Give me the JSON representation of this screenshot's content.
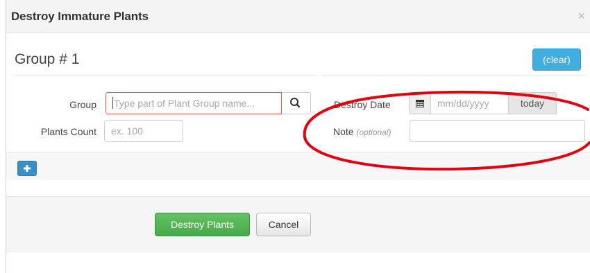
{
  "modal": {
    "title": "Destroy Immature Plants",
    "close_glyph": "×"
  },
  "group": {
    "title": "Group # 1",
    "clear_label": "(clear)",
    "group_label": "Group",
    "group_placeholder": "Type part of Plant Group name...",
    "search_icon": "search-icon",
    "plants_count_label": "Plants Count",
    "plants_count_placeholder": "ex. 100",
    "destroy_date_label": "Destroy Date",
    "calendar_icon": "calendar-icon",
    "date_placeholder": "mm/dd/yyyy",
    "today_label": "today",
    "note_label": "Note",
    "note_optional": "(optional)",
    "note_value": "",
    "add_icon": "plus-icon"
  },
  "footer": {
    "destroy_label": "Destroy Plants",
    "cancel_label": "Cancel"
  },
  "colors": {
    "accent_blue": "#41aee0",
    "add_blue": "#3a8fc4",
    "success_green": "#5cb85c",
    "error_border": "#e05a5a",
    "annotation_red": "#e0000f"
  }
}
